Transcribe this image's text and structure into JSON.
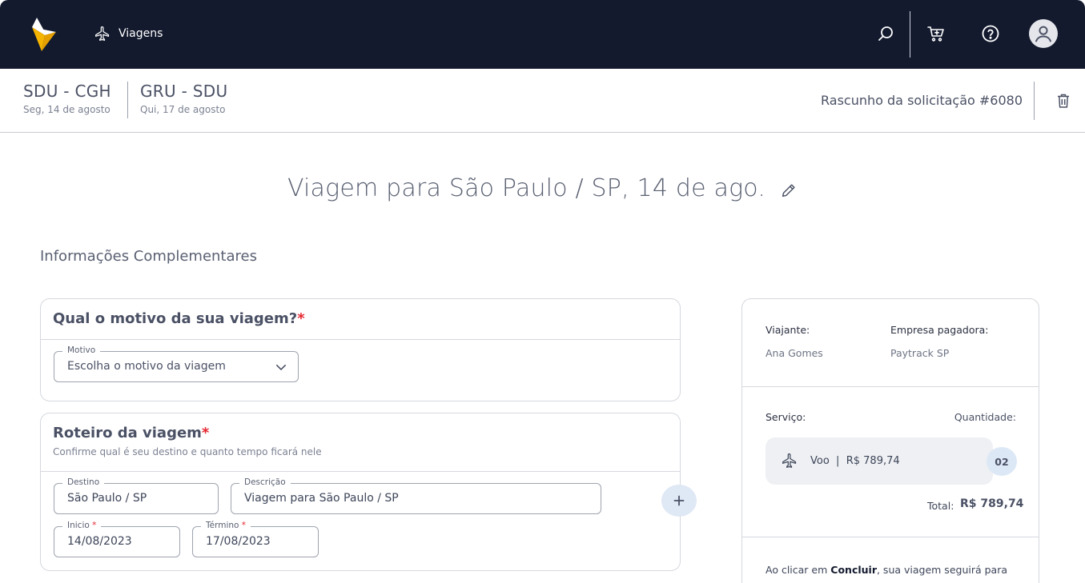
{
  "nav": {
    "menu_label": "Viagens",
    "icons": [
      "search-icon",
      "cart-icon",
      "help-icon",
      "user-avatar-icon"
    ],
    "brand_color": "#131a2e",
    "logo_color": "#f5b400"
  },
  "header": {
    "routes": [
      {
        "code": "SDU - CGH",
        "date": "Seg, 14 de agosto"
      },
      {
        "code": "GRU - SDU",
        "date": "Qui, 17 de agosto"
      }
    ],
    "draft_label": "Rascunho da solicitação #6080"
  },
  "trip": {
    "title": "Viagem para São Paulo / SP, 14 de ago."
  },
  "section": {
    "title": "Informações Complementares"
  },
  "motivo": {
    "question": "Qual o motivo da sua viagem?",
    "required_mark": "*",
    "field_legend": "Motivo",
    "placeholder": "Escolha o motivo da viagem"
  },
  "roteiro": {
    "title": "Roteiro da viagem",
    "required_mark": "*",
    "subtitle": "Confirme qual é seu destino e quanto tempo ficará nele",
    "destino_legend": "Destino",
    "destino_value": "São Paulo / SP",
    "descricao_legend": "Descrição",
    "descricao_value": "Viagem para São Paulo / SP",
    "inicio_legend": "Inicio",
    "inicio_value": "14/08/2023",
    "termino_legend": "Término",
    "termino_value": "17/08/2023"
  },
  "summary": {
    "traveler_label": "Viajante:",
    "traveler_value": "Ana Gomes",
    "company_label": "Empresa pagadora:",
    "company_value": "Paytrack SP",
    "service_label": "Serviço:",
    "quantity_label": "Quantidade:",
    "service_name": "Voo",
    "service_price": "R$ 789,74",
    "service_qty": "02",
    "total_label": "Total:",
    "total_value": "R$ 789,74",
    "note_prefix": "Ao clicar em",
    "note_bold": "Concluir",
    "note_suffix": ", sua viagem seguirá para"
  }
}
